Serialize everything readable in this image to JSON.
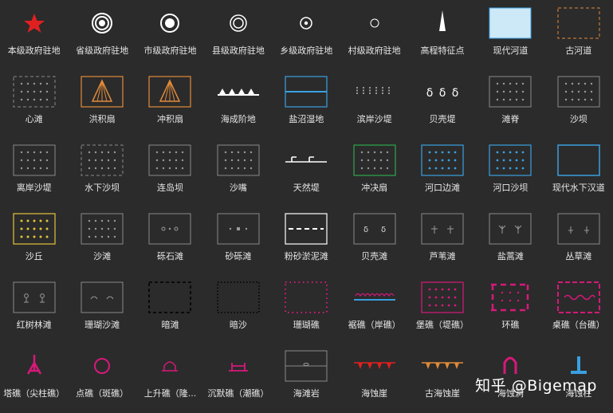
{
  "colors": {
    "background": "#2b2b2b",
    "box_gray": "#8a8a8a",
    "dot_gray": "#9a9a9a",
    "red": "#e02020",
    "orange": "#e08a3a",
    "blue": "#3aa0e0",
    "green": "#2ea84a",
    "yellow": "#e5c23a",
    "magenta": "#d6197a",
    "light_blue_fill": "#cde8f7"
  },
  "legend": {
    "items": [
      {
        "label": "本级政府驻地",
        "icon": "red-star-icon"
      },
      {
        "label": "省级政府驻地",
        "icon": "triple-ring-icon"
      },
      {
        "label": "市级政府驻地",
        "icon": "double-ring-dot-icon"
      },
      {
        "label": "县级政府驻地",
        "icon": "double-ring-icon"
      },
      {
        "label": "乡级政府驻地",
        "icon": "ring-dot-icon"
      },
      {
        "label": "村级政府驻地",
        "icon": "small-ring-icon"
      },
      {
        "label": "高程特征点",
        "icon": "peak-icon"
      },
      {
        "label": "现代河道",
        "icon": "filled-blue-box-icon"
      },
      {
        "label": "古河道",
        "icon": "orange-dashed-box-icon"
      },
      {
        "label": "心滩",
        "icon": "gray-dashed-dot-box-icon"
      },
      {
        "label": "洪积扇",
        "icon": "orange-fan-box-icon"
      },
      {
        "label": "冲积扇",
        "icon": "orange-fan-box-icon"
      },
      {
        "label": "海成阶地",
        "icon": "terrace-triangles-icon"
      },
      {
        "label": "盐沼湿地",
        "icon": "blue-split-box-icon"
      },
      {
        "label": "滨岸沙堤",
        "icon": "tick-row-icon"
      },
      {
        "label": "贝壳堤",
        "icon": "shell-row-icon"
      },
      {
        "label": "滩脊",
        "icon": "gray-dot-box-icon"
      },
      {
        "label": "沙坝",
        "icon": "gray-dot-box-icon"
      },
      {
        "label": "离岸沙堤",
        "icon": "gray-dot-box-icon"
      },
      {
        "label": "水下沙坝",
        "icon": "gray-dashed-dot-box-icon"
      },
      {
        "label": "连岛坝",
        "icon": "gray-dot-box-icon"
      },
      {
        "label": "沙嘴",
        "icon": "gray-dot-box-icon"
      },
      {
        "label": "天然堤",
        "icon": "levee-line-icon"
      },
      {
        "label": "冲决扇",
        "icon": "green-dot-box-icon"
      },
      {
        "label": "河口边滩",
        "icon": "blue-dot-box-icon"
      },
      {
        "label": "河口沙坝",
        "icon": "blue-dot-box-icon"
      },
      {
        "label": "现代水下汉道",
        "icon": "blue-box-icon"
      },
      {
        "label": "沙丘",
        "icon": "yellow-dot-box-icon"
      },
      {
        "label": "沙滩",
        "icon": "gray-dot-box-icon"
      },
      {
        "label": "砾石滩",
        "icon": "gravel-box-icon"
      },
      {
        "label": "砂砾滩",
        "icon": "sand-gravel-box-icon"
      },
      {
        "label": "粉砂淤泥滩",
        "icon": "silt-box-icon"
      },
      {
        "label": "贝壳滩",
        "icon": "shell-box-icon"
      },
      {
        "label": "芦苇滩",
        "icon": "reed-box-icon"
      },
      {
        "label": "盐蒿滩",
        "icon": "salt-herb-box-icon"
      },
      {
        "label": "丛草滩",
        "icon": "grass-box-icon"
      },
      {
        "label": "红树林滩",
        "icon": "mangrove-box-icon"
      },
      {
        "label": "珊瑚沙滩",
        "icon": "coral-sand-box-icon"
      },
      {
        "label": "暗滩",
        "icon": "black-dashed-box-icon"
      },
      {
        "label": "暗沙",
        "icon": "black-dotted-box-icon"
      },
      {
        "label": "珊瑚礁",
        "icon": "magenta-dotted-box-icon"
      },
      {
        "label": "裾礁（岸礁）",
        "icon": "fringing-reef-icon"
      },
      {
        "label": "堡礁（堤礁）",
        "icon": "magenta-dot-box-icon"
      },
      {
        "label": "环礁",
        "icon": "atoll-icon"
      },
      {
        "label": "桌礁（台礁）",
        "icon": "table-reef-icon"
      },
      {
        "label": "塔礁（尖柱礁）",
        "icon": "tower-reef-icon"
      },
      {
        "label": "点礁（斑礁）",
        "icon": "patch-reef-ring-icon"
      },
      {
        "label": "上升礁（隆...",
        "icon": "uplifted-reef-icon"
      },
      {
        "label": "沉默礁（潮礁）",
        "icon": "submerged-reef-icon"
      },
      {
        "label": "海滩岩",
        "icon": "beach-rock-box-icon"
      },
      {
        "label": "海蚀崖",
        "icon": "red-cliff-icon"
      },
      {
        "label": "古海蚀崖",
        "icon": "orange-cliff-icon"
      },
      {
        "label": "海蚀洞",
        "icon": "sea-cave-icon"
      },
      {
        "label": "海蚀柱",
        "icon": "sea-stack-icon"
      }
    ]
  },
  "watermark": "知乎 @Bigemap"
}
